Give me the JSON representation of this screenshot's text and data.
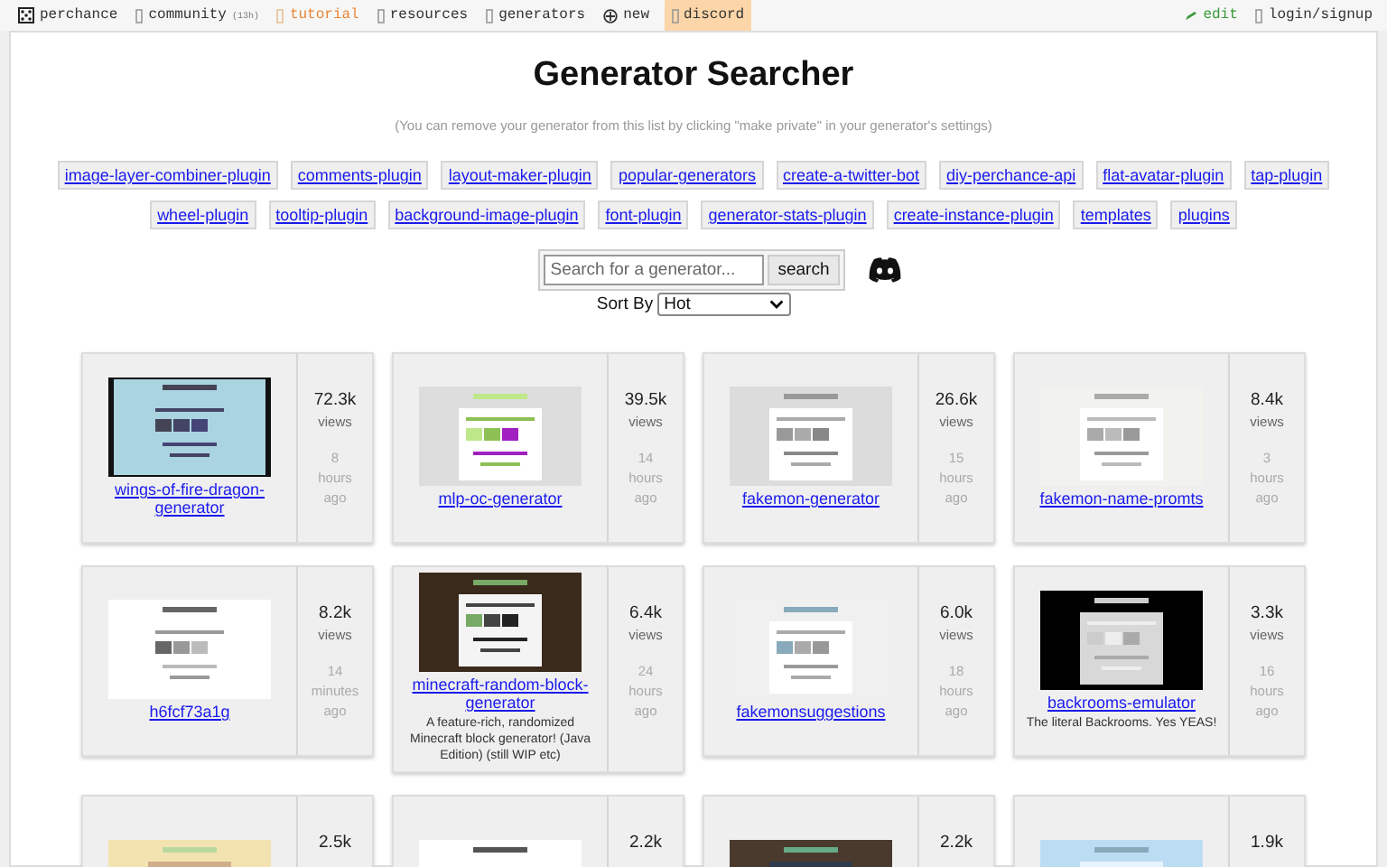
{
  "nav_left": [
    {
      "label": "perchance",
      "selected": false
    },
    {
      "label": "community",
      "badge": "(13h)",
      "selected": false
    },
    {
      "label": "tutorial",
      "selected": false
    },
    {
      "label": "resources",
      "selected": false
    },
    {
      "label": "generators",
      "selected": false
    },
    {
      "label": "new",
      "selected": false
    },
    {
      "label": "discord",
      "selected": true
    }
  ],
  "nav_right": [
    {
      "label": "edit"
    },
    {
      "label": "login/signup"
    }
  ],
  "title": "Generator Searcher",
  "subtitle": "(You can remove your generator from this list by clicking \"make private\" in your generator's settings)",
  "tags": [
    "image-layer-combiner-plugin",
    "comments-plugin",
    "layout-maker-plugin",
    "popular-generators",
    "create-a-twitter-bot",
    "diy-perchance-api",
    "flat-avatar-plugin",
    "tap-plugin",
    "wheel-plugin",
    "tooltip-plugin",
    "background-image-plugin",
    "font-plugin",
    "generator-stats-plugin",
    "create-instance-plugin",
    "templates",
    "plugins"
  ],
  "search": {
    "placeholder": "Search for a generator...",
    "button": "search"
  },
  "sort": {
    "label": "Sort By",
    "value": "Hot"
  },
  "cards": [
    {
      "title": "wings-of-fire-dragon-generator",
      "views": "72.3k",
      "views_label": "views",
      "age": [
        "8",
        "hours",
        "ago"
      ]
    },
    {
      "title": "mlp-oc-generator",
      "views": "39.5k",
      "views_label": "views",
      "age": [
        "14",
        "hours",
        "ago"
      ]
    },
    {
      "title": "fakemon-generator",
      "views": "26.6k",
      "views_label": "views",
      "age": [
        "15",
        "hours",
        "ago"
      ]
    },
    {
      "title": "fakemon-name-promts",
      "views": "8.4k",
      "views_label": "views",
      "age": [
        "3",
        "hours",
        "ago"
      ]
    },
    {
      "title": "h6fcf73a1g",
      "views": "8.2k",
      "views_label": "views",
      "age": [
        "14",
        "minutes",
        "ago"
      ]
    },
    {
      "title": "minecraft-random-block-generator",
      "description": "A feature-rich, randomized Minecraft block generator! (Java Edition) (still WIP etc)",
      "views": "6.4k",
      "views_label": "views",
      "age": [
        "24",
        "hours",
        "ago"
      ]
    },
    {
      "title": "fakemonsuggestions",
      "views": "6.0k",
      "views_label": "views",
      "age": [
        "18",
        "hours",
        "ago"
      ]
    },
    {
      "title": "backrooms-emulator",
      "description": "The literal Backrooms. Yes YEAS!",
      "views": "3.3k",
      "views_label": "views",
      "age": [
        "16",
        "hours",
        "ago"
      ]
    },
    {
      "views": "2.5k"
    },
    {
      "views": "2.2k"
    },
    {
      "views": "2.2k"
    },
    {
      "views": "1.9k"
    }
  ]
}
